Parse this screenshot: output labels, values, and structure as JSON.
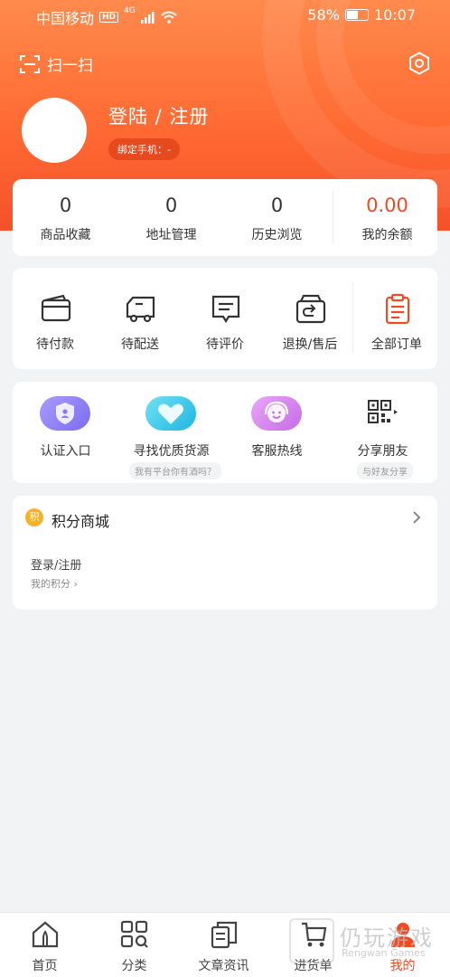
{
  "status": {
    "carrier": "中国移动",
    "hd": "HD",
    "network": "4G",
    "battery": "58%",
    "battery_level": 0.58,
    "time": "10:07"
  },
  "header": {
    "scan_label": "扫一扫",
    "login_title": "登陆 / 注册",
    "phone_label": "绑定手机：-"
  },
  "stats": [
    {
      "value": "0",
      "label": "商品收藏"
    },
    {
      "value": "0",
      "label": "地址管理"
    },
    {
      "value": "0",
      "label": "历史浏览"
    },
    {
      "value": "0.00",
      "label": "我的余额"
    }
  ],
  "orders": [
    {
      "label": "待付款",
      "icon": "wallet-icon"
    },
    {
      "label": "待配送",
      "icon": "truck-icon"
    },
    {
      "label": "待评价",
      "icon": "comment-icon"
    },
    {
      "label": "退换/售后",
      "icon": "return-box-icon"
    },
    {
      "label": "全部订单",
      "icon": "clipboard-icon"
    }
  ],
  "services": [
    {
      "label": "认证入口",
      "sub": "",
      "icon": "shield-user-icon",
      "color": "#8b7cf6"
    },
    {
      "label": "寻找优质货源",
      "sub": "我有平台你有酒吗？",
      "icon": "heart-icon",
      "color": "#34c8e8"
    },
    {
      "label": "客服热线",
      "sub": "",
      "icon": "headset-icon",
      "color": "#d889ee"
    },
    {
      "label": "分享朋友",
      "sub": "与好友分享",
      "icon": "qrcode-icon",
      "color": "#333333"
    }
  ],
  "points": {
    "badge": "积",
    "title": "积分商城",
    "login": "登录/注册",
    "mine": "我的积分 ›"
  },
  "tabs": [
    {
      "label": "首页",
      "icon": "home-icon"
    },
    {
      "label": "分类",
      "icon": "category-icon"
    },
    {
      "label": "文章资讯",
      "icon": "article-icon"
    },
    {
      "label": "进货单",
      "icon": "cart-icon"
    },
    {
      "label": "我的",
      "icon": "profile-icon"
    }
  ],
  "watermark": {
    "text": "仍玩游戏",
    "sub": "Rengwan Games"
  },
  "colors": {
    "accent": "#f04a23",
    "header_top": "#ff8a4c",
    "header_bottom": "#f5512a"
  }
}
